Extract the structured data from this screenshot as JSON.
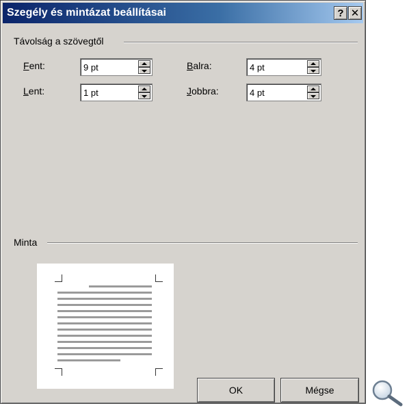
{
  "window": {
    "title": "Szegély és mintázat beállításai",
    "help_label": "?",
    "close_label": "✕"
  },
  "spacing_group": {
    "label": "Távolság a szövegtől",
    "top": {
      "label_first": "F",
      "label_rest": "ent:",
      "value": "9 pt"
    },
    "bottom": {
      "label_first": "L",
      "label_rest": "ent:",
      "value": "1 pt"
    },
    "left": {
      "label_first": "B",
      "label_rest": "alra:",
      "value": "4 pt"
    },
    "right": {
      "label_first": "J",
      "label_rest": "obbra:",
      "value": "4 pt"
    }
  },
  "preview_group": {
    "label": "Minta"
  },
  "buttons": {
    "ok_label": "OK",
    "cancel_label": "Mégse"
  },
  "icons": {
    "zoom": "magnifier-icon",
    "spin_up": "arrow-up-icon",
    "spin_down": "arrow-down-icon"
  }
}
